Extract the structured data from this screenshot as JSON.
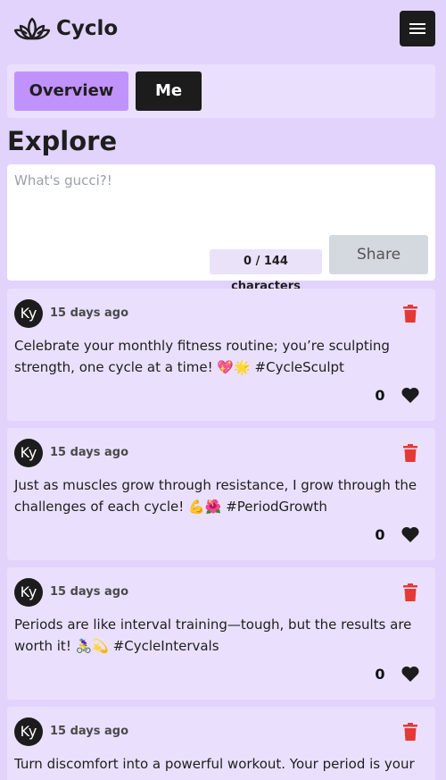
{
  "app": {
    "brand": "Cyclo",
    "logo_icon": "lotus-icon",
    "menu_icon": "hamburger-icon"
  },
  "tabs": [
    {
      "label": "Overview",
      "active": true
    },
    {
      "label": "Me",
      "active": false
    }
  ],
  "page_title": "Explore",
  "composer": {
    "placeholder": "What's gucci?!",
    "value": "",
    "char_count": "0 / 144 characters",
    "share_label": "Share"
  },
  "colors": {
    "background": "#e2d3fc",
    "accent": "#c092fb",
    "dark": "#1c1c1c",
    "delete": "#e53935"
  },
  "posts": [
    {
      "avatar_initials": "Ky",
      "timestamp": "15 days ago",
      "body_line1": "Celebrate your monthly fitness routine; you’re sculpting",
      "body_line2": "strength, one cycle at a time! 💖🌟 #CycleSculpt",
      "likes": "0"
    },
    {
      "avatar_initials": "Ky",
      "timestamp": "15 days ago",
      "body_line1": "Just as muscles grow through resistance, I grow through the",
      "body_line2": "challenges of each cycle! 💪🌺 #PeriodGrowth",
      "likes": "0"
    },
    {
      "avatar_initials": "Ky",
      "timestamp": "15 days ago",
      "body_line1": "Periods are like interval training—tough, but the results are",
      "body_line2": "worth it! 🚴‍♀️💫 #CycleIntervals",
      "likes": "0"
    },
    {
      "avatar_initials": "Ky",
      "timestamp": "15 days ago",
      "body_line1": "Turn discomfort into a powerful workout. Your period is your",
      "body_line2": "",
      "likes": "0"
    }
  ]
}
